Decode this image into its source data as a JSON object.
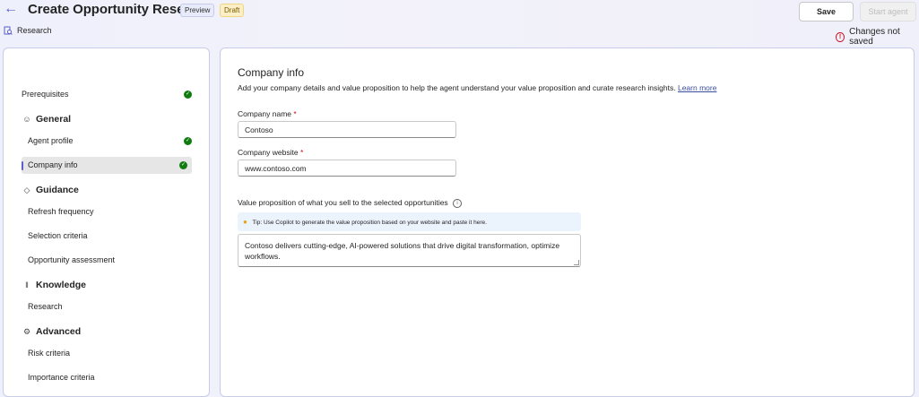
{
  "header": {
    "title": "Create Opportunity Research",
    "badges": {
      "preview": "Preview",
      "draft": "Draft"
    },
    "save_label": "Save",
    "start_label": "Start agent",
    "tab_label": "Research",
    "status": "Changes not saved"
  },
  "sidebar": {
    "prerequisites": "Prerequisites",
    "general": {
      "title": "General",
      "agent_profile": "Agent profile",
      "company_info": "Company info"
    },
    "guidance": {
      "title": "Guidance",
      "refresh": "Refresh frequency",
      "selection": "Selection criteria",
      "assessment": "Opportunity assessment"
    },
    "knowledge": {
      "title": "Knowledge",
      "research": "Research"
    },
    "advanced": {
      "title": "Advanced",
      "risk": "Risk criteria",
      "importance": "Importance criteria"
    }
  },
  "main": {
    "title": "Company info",
    "description": "Add your company details and value proposition to help the agent understand your value proposition and curate research insights.",
    "learn_more": "Learn more",
    "company_name": {
      "label": "Company name",
      "value": "Contoso"
    },
    "company_website": {
      "label": "Company website",
      "value": "www.contoso.com"
    },
    "value_prop": {
      "label": "Value proposition of what you sell to the selected opportunities",
      "tip": "Tip: Use Copilot to generate the value proposition based on your website and paste it here.",
      "value": "Contoso delivers cutting-edge, AI-powered solutions that drive digital transformation, optimize workflows."
    },
    "required_mark": "*"
  },
  "colors": {
    "accent": "#5b5fc7",
    "success": "#107c10",
    "error": "#c50f1f",
    "link": "#3c4ea1"
  },
  "icons": [
    "back-arrow-icon",
    "research-icon",
    "error-circle-icon",
    "check-circle-icon",
    "person-icon",
    "guidance-icon",
    "library-icon",
    "settings-icon",
    "info-icon",
    "lightbulb-icon"
  ]
}
